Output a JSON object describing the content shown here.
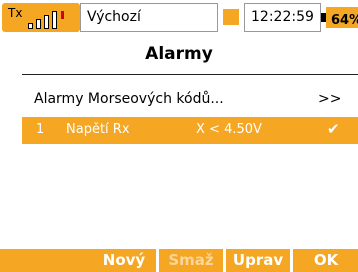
{
  "status_bar": {
    "tx_label": "Tx",
    "profile": "Výchozí",
    "time": "12:22:59",
    "battery": "64%"
  },
  "title": "Alarmy",
  "menu_item": {
    "label": "Alarmy Morseových kódů...",
    "arrow": ">>"
  },
  "alarms": [
    {
      "num": "1",
      "name": "Napětí Rx",
      "condition": "X < 4.50V",
      "check": "✔"
    }
  ],
  "buttons": {
    "new": "Nový",
    "delete": "Smaž",
    "edit": "Uprav",
    "ok": "OK"
  },
  "colors": {
    "accent": "#f5a623",
    "alarm_red": "#d0021b"
  }
}
